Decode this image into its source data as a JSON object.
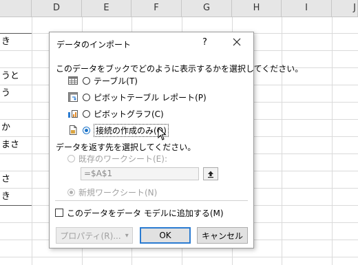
{
  "sheet": {
    "columns": [
      "D",
      "E",
      "F",
      "G",
      "H",
      "I",
      "J"
    ],
    "cells": [
      "き",
      "うと",
      "う",
      "か",
      "まさ",
      "さ",
      "き"
    ]
  },
  "dialog": {
    "title": "データのインポート",
    "help": "?",
    "prompt": "このデータをブックでどのように表示するかを選択してください。",
    "options": [
      {
        "label": "テーブル(T)",
        "icon": "table-icon",
        "checked": false
      },
      {
        "label": "ピボットテーブル レポート(P)",
        "icon": "pivot-table-icon",
        "checked": false
      },
      {
        "label": "ピボットグラフ(C)",
        "icon": "pivot-chart-icon",
        "checked": false
      },
      {
        "label": "接続の作成のみ(O)",
        "icon": "connection-icon",
        "checked": true
      }
    ],
    "destination_prompt": "データを返す先を選択してください。",
    "existing_sheet_label": "既存のワークシート(E):",
    "range_value": "=$A$1",
    "new_sheet_label": "新規ワークシート(N)",
    "add_to_model_label": "このデータをデータ モデルに追加する(M)",
    "buttons": {
      "properties": "プロパティ(R)...",
      "properties_arrow": "▾",
      "ok": "OK",
      "cancel": "キャンセル"
    }
  },
  "colors": {
    "accent": "#2a7bd1",
    "radio_checked": "#1a73c8"
  }
}
